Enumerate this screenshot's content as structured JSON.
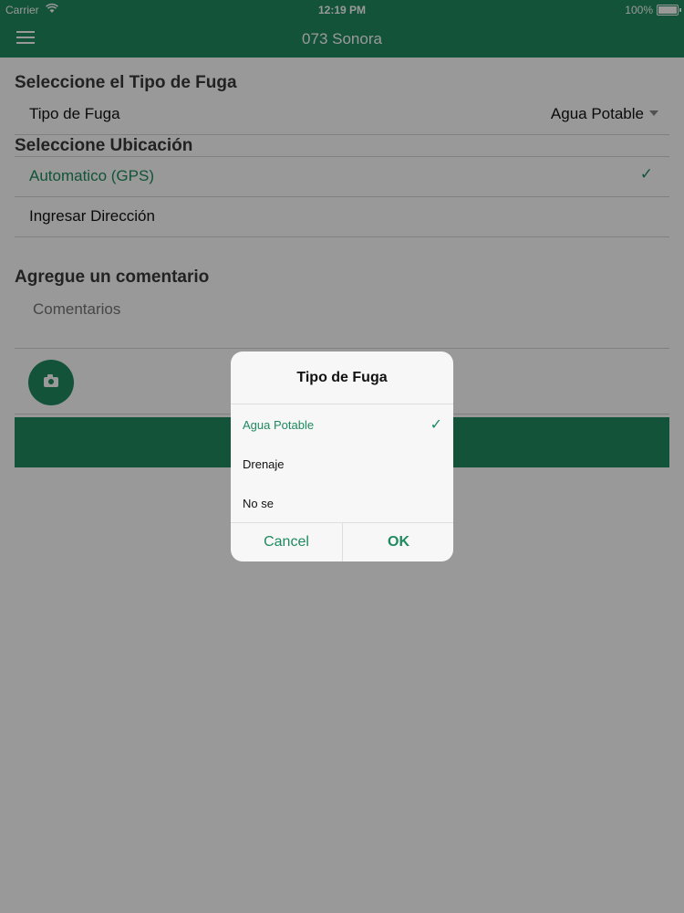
{
  "status_bar": {
    "carrier": "Carrier",
    "time": "12:19 PM",
    "battery": "100%"
  },
  "nav": {
    "title": "073 Sonora",
    "menu_icon": "hamburger-menu-icon"
  },
  "form": {
    "section_leak_type": "Seleccione el Tipo de Fuga",
    "leak_type_label": "Tipo de Fuga",
    "leak_type_value": "Agua Potable",
    "section_location": "Seleccione Ubicación",
    "location_options": [
      "Automatico (GPS)",
      "Ingresar Dirección"
    ],
    "location_selected": "Automatico (GPS)",
    "section_comment": "Agregue un comentario",
    "comment_placeholder": "Comentarios",
    "camera_icon": "camera-icon"
  },
  "dialog": {
    "title": "Tipo de Fuga",
    "options": [
      "Agua Potable",
      "Drenaje",
      "No se"
    ],
    "selected": "Agua Potable",
    "cancel_label": "Cancel",
    "ok_label": "OK"
  },
  "colors": {
    "accent": "#1e8a5f",
    "overlay": "rgba(0,0,0,0.4)"
  }
}
